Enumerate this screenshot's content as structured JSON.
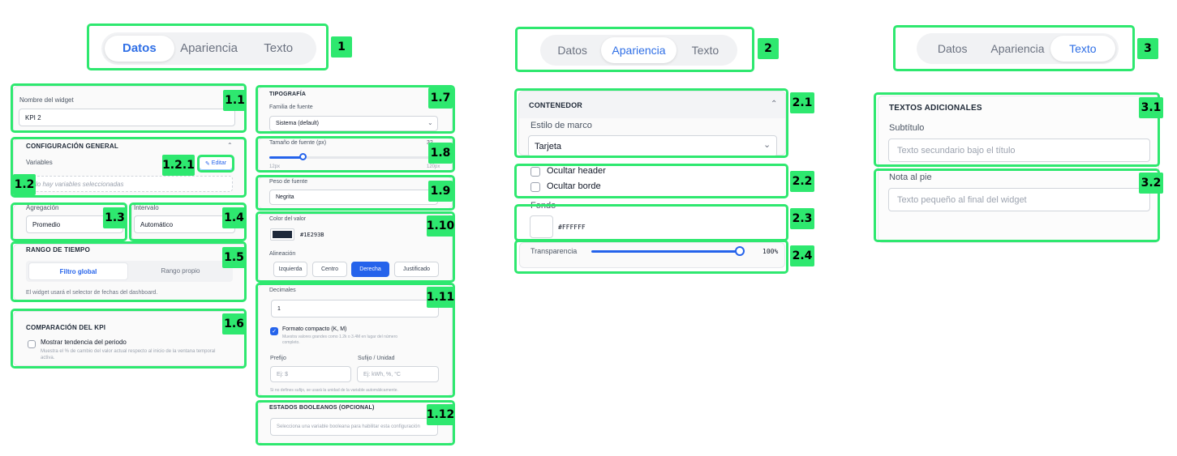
{
  "tabs": [
    "Datos",
    "Apariencia",
    "Texto"
  ],
  "markers": {
    "m1": "1",
    "m11": "1.1",
    "m121": "1.2.1",
    "m12": "1.2",
    "m13": "1.3",
    "m14": "1.4",
    "m15": "1.5",
    "m16": "1.6",
    "m17": "1.7",
    "m18": "1.8",
    "m19": "1.9",
    "m110": "1.10",
    "m111": "1.11",
    "m112": "1.12",
    "m2": "2",
    "m21": "2.1",
    "m22": "2.2",
    "m23": "2.3",
    "m24": "2.4",
    "m3": "3",
    "m31": "3.1",
    "m32": "3.2"
  },
  "datos": {
    "widget_name_label": "Nombre del widget",
    "widget_name_value": "KPI 2",
    "config_title": "CONFIGURACIÓN GENERAL",
    "variables_label": "Variables",
    "edit_label": "Editar",
    "no_variables": "No hay variables seleccionadas",
    "agregacion_label": "Agregación",
    "agregacion_value": "Promedio",
    "intervalo_label": "Intervalo",
    "intervalo_value": "Automático",
    "rango_title": "RANGO DE TIEMPO",
    "rango_opt1": "Filtro global",
    "rango_opt2": "Rango propio",
    "rango_help": "El widget usará el selector de fechas del dashboard.",
    "comparacion_title": "COMPARACIÓN DEL KPI",
    "tendencia_label": "Mostrar tendencia del periodo",
    "tendencia_help": "Muestra el % de cambio del valor actual respecto al inicio de la ventana temporal activa.",
    "tipografia_title": "TIPOGRAFÍA",
    "familia_label": "Familia de fuente",
    "familia_value": "Sistema (default)",
    "tamano_label": "Tamaño de fuente (px)",
    "tamano_value": "32",
    "tamano_min": "12px",
    "tamano_max": "120px",
    "tamano_fraction": 0.2,
    "peso_label": "Peso de fuente",
    "peso_value": "Negrita",
    "color_label": "Color del valor",
    "color_value": "#1E293B",
    "alineacion_label": "Alineación",
    "alineacion_opts": [
      "Izquierda",
      "Centro",
      "Derecha",
      "Justificado"
    ],
    "decimales_label": "Decimales",
    "decimales_value": "1",
    "compacto_label": "Formato compacto (K, M)",
    "compacto_help": "Muestra valores grandes como 1.2k o 3.4M en lugar del número completo.",
    "prefijo_label": "Prefijo",
    "prefijo_ph": "Ej: $",
    "sufijo_label": "Sufijo / Unidad",
    "sufijo_ph": "Ej: kWh, %, °C",
    "sufijo_help": "Si no defines sufijo, se usará la unidad de la variable automáticamente.",
    "booleanos_title": "ESTADOS BOOLEANOS (OPCIONAL)",
    "booleanos_help": "Selecciona una variable booleana para habilitar esta configuración"
  },
  "apariencia": {
    "contenedor_title": "CONTENEDOR",
    "marco_label": "Estilo de marco",
    "marco_value": "Tarjeta",
    "ocultar_header": "Ocultar header",
    "ocultar_borde": "Ocultar borde",
    "fondo_label": "Fondo",
    "fondo_value": "#FFFFFF",
    "transparencia_label": "Transparencia",
    "transparencia_value": "100%",
    "transparencia_fraction": 1.0
  },
  "texto": {
    "adicionales_title": "TEXTOS ADICIONALES",
    "subtitulo_label": "Subtítulo",
    "subtitulo_ph": "Texto secundario bajo el título",
    "nota_label": "Nota al pie",
    "nota_ph": "Texto pequeño al final del widget"
  },
  "colors": {
    "accent": "#2563eb",
    "highlight": "#2ee86f",
    "swatch": "#1E293B"
  },
  "icons": {
    "edit": "pencil-icon",
    "chevron": "chevron-down-icon",
    "collapse": "chevron-up-icon",
    "check": "check-icon"
  }
}
